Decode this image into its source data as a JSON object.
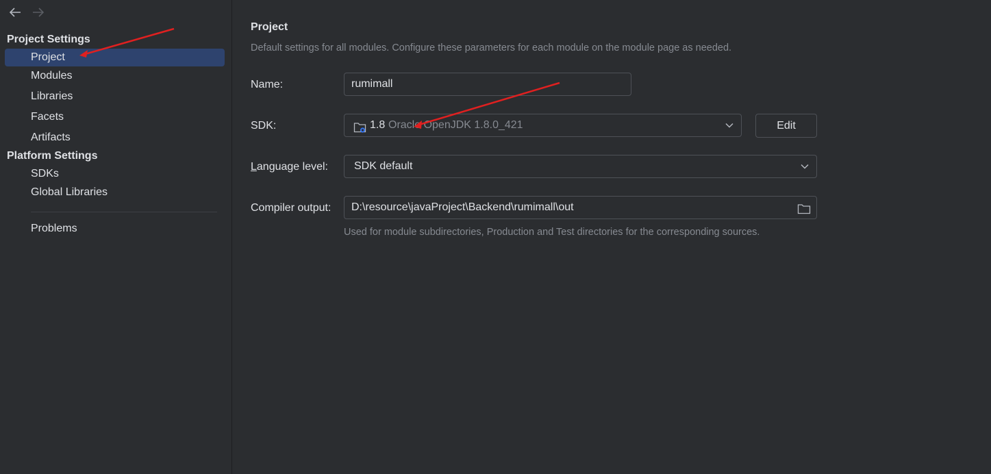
{
  "nav": {
    "back_icon": "arrow-left-icon",
    "forward_icon": "arrow-right-icon"
  },
  "sidebar": {
    "project_settings_header": "Project Settings",
    "project_items": [
      {
        "label": "Project",
        "selected": true
      },
      {
        "label": "Modules",
        "selected": false
      },
      {
        "label": "Libraries",
        "selected": false
      },
      {
        "label": "Facets",
        "selected": false
      },
      {
        "label": "Artifacts",
        "selected": false
      }
    ],
    "platform_settings_header": "Platform Settings",
    "platform_items": [
      {
        "label": "SDKs"
      },
      {
        "label": "Global Libraries"
      }
    ],
    "problems_label": "Problems"
  },
  "main": {
    "title": "Project",
    "description": "Default settings for all modules. Configure these parameters for each module on the module page as needed.",
    "name_label": "Name:",
    "name_value": "rumimall",
    "sdk_label": "SDK:",
    "sdk_version": "1.8",
    "sdk_vendor": "Oracle OpenJDK 1.8.0_421",
    "edit_label": "Edit",
    "language_level_label_mnemonic": "L",
    "language_level_label_rest": "anguage level:",
    "language_level_value": "SDK default",
    "compiler_output_label": "Compiler output:",
    "compiler_output_value": "D:\\resource\\javaProject\\Backend\\rumimall\\out",
    "compiler_output_hint": "Used for module subdirectories, Production and Test directories for the corresponding sources."
  },
  "colors": {
    "background": "#2b2d30",
    "selection": "#2e436e",
    "annotation_arrow": "#e02020",
    "muted_text": "#868a91"
  }
}
